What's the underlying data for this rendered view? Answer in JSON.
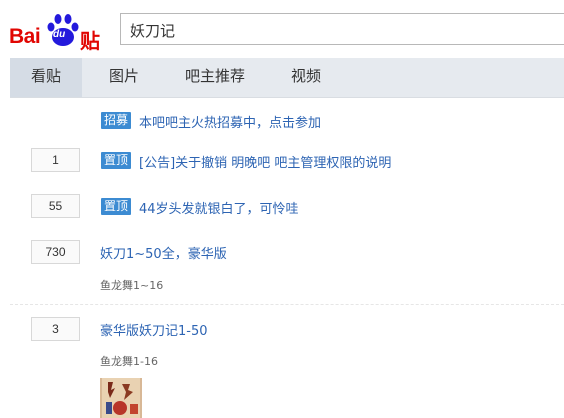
{
  "header": {
    "logo": {
      "bai": "Bai",
      "du": "du",
      "tieba": "贴吧"
    },
    "search_value": "妖刀记"
  },
  "tabs": [
    {
      "label": "看贴",
      "active": true
    },
    {
      "label": "图片"
    },
    {
      "label": "吧主推荐"
    },
    {
      "label": "视频"
    }
  ],
  "threads": [
    {
      "badge": "招募",
      "title": "本吧吧主火热招募中，点击参加"
    },
    {
      "reply_count": "1",
      "badge": "置顶",
      "title": "[公告]关于撤销 明晚吧 吧主管理权限的说明"
    },
    {
      "reply_count": "55",
      "badge": "置顶",
      "title": "44岁头发就银白了，可怜哇"
    },
    {
      "reply_count": "730",
      "title": "妖刀1~50全，豪华版",
      "author": "鱼龙舞1~16"
    },
    {
      "reply_count": "3",
      "title": "豪华版妖刀记1-50",
      "author": "鱼龙舞1-16",
      "thumbnail_icon": "book-cover-thumbnail"
    }
  ],
  "colors": {
    "brand_red": "#e10602",
    "brand_blue": "#2319dc",
    "badge_blue": "#3c8bd2",
    "link_blue": "#2d64b3"
  }
}
